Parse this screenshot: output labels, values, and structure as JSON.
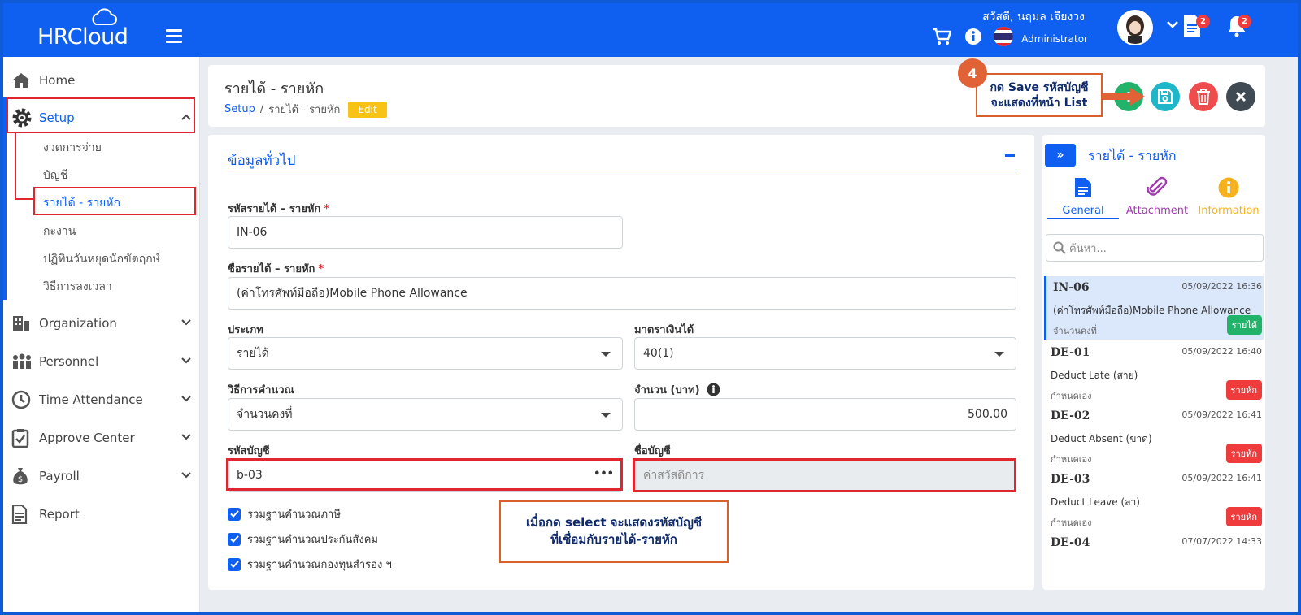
{
  "header": {
    "logo": "HRCloud",
    "greeting": "สวัสดี, นฤมล เจียงวง",
    "role": "Administrator",
    "notif_doc_count": "2",
    "notif_bell_count": "2"
  },
  "sidebar": {
    "home": "Home",
    "setup": "Setup",
    "setup_sub": [
      "งวดการจ่าย",
      "บัญชี",
      "รายได้ - รายหัก",
      "กะงาน",
      "ปฏิทินวันหยุดนักขัตฤกษ์",
      "วิธีการลงเวลา"
    ],
    "organization": "Organization",
    "personnel": "Personnel",
    "time_attendance": "Time Attendance",
    "approve_center": "Approve Center",
    "payroll": "Payroll",
    "report": "Report"
  },
  "page": {
    "title": "รายได้ - รายหัก",
    "crumb_root": "Setup",
    "crumb_current": "รายได้ - รายหัก",
    "mode_badge": "Edit"
  },
  "form": {
    "section_title": "ข้อมูลทั่วไป",
    "code_label": "รหัสรายได้ – รายหัก",
    "code_value": "IN-06",
    "name_label": "ชื่อรายได้ – รายหัก",
    "name_value": "(ค่าโทรศัพท์มือถือ)Mobile Phone Allowance",
    "type_label": "ประเภท",
    "type_value": "รายได้",
    "section_label": "มาตราเงินได้",
    "section_value": "40(1)",
    "calc_label": "วิธีการคำนวณ",
    "calc_value": "จำนวนคงที่",
    "amount_label": "จำนวน (บาท)",
    "amount_value": "500.00",
    "acct_code_label": "รหัสบัญชี",
    "acct_code_value": "b-03",
    "acct_name_label": "ชื่อบัญชี",
    "acct_name_value": "ค่าสวัสดิการ",
    "checkboxes": [
      "รวมฐานคำนวณภาษี",
      "รวมฐานคำนวณประกันสังคม",
      "รวมฐานคำนวณกองทุนสำรอง ฯ"
    ],
    "required_mark": "*",
    "select_icon": "•••"
  },
  "callouts": {
    "step_number": "4",
    "save_line1": "กด Save รหัสบัญชี",
    "save_line2": "จะแสดงที่หน้า List",
    "select_line1": "เมื่อกด select จะแสดงรหัสบัญชี",
    "select_line2": "ที่เชื่อมกับรายได้-รายหัก"
  },
  "right_panel": {
    "title": "รายได้ - รายหัก",
    "toggle": "»",
    "tabs": [
      "General",
      "Attachment",
      "Information"
    ],
    "search_placeholder": "ค้นหา...",
    "items": [
      {
        "code": "IN-06",
        "date": "05/09/2022 16:36",
        "name": "(ค่าโทรศัพท์มือถือ)Mobile Phone Allowance",
        "sub": "จำนวนคงที่",
        "tag": "รายได้",
        "tag_color": "#22b36b"
      },
      {
        "code": "DE-01",
        "date": "05/09/2022 16:40",
        "name": "Deduct Late (สาย)",
        "sub": "กำหนดเอง",
        "tag": "รายหัก",
        "tag_color": "#ef3b3b"
      },
      {
        "code": "DE-02",
        "date": "05/09/2022 16:41",
        "name": "Deduct Absent (ขาด)",
        "sub": "กำหนดเอง",
        "tag": "รายหัก",
        "tag_color": "#ef3b3b"
      },
      {
        "code": "DE-03",
        "date": "05/09/2022 16:41",
        "name": "Deduct Leave (ลา)",
        "sub": "กำหนดเอง",
        "tag": "รายหัก",
        "tag_color": "#ef3b3b"
      },
      {
        "code": "DE-04",
        "date": "07/07/2022 14:33"
      }
    ]
  },
  "colors": {
    "primary": "#0f5ff0",
    "annotation_red": "#e0272f",
    "callout_orange": "#d9602c",
    "save_cyan": "#1fb6c9",
    "delete_red": "#ef4d4d",
    "close_dark": "#3f4a52"
  }
}
